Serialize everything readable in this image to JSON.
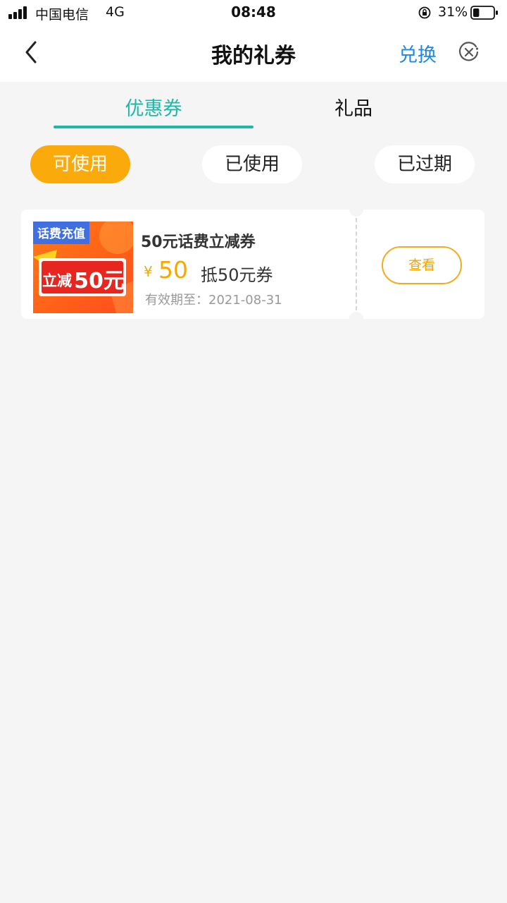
{
  "status_bar": {
    "carrier": "中国电信",
    "network": "4G",
    "time": "08:48",
    "battery_percent": "31%",
    "battery_level": 0.31,
    "icons": [
      "signal-icon",
      "orientation-lock-icon",
      "battery-icon"
    ]
  },
  "nav": {
    "title": "我的礼券",
    "exchange_label": "兑换",
    "back_icon": "back-chevron-icon",
    "close_icon": "close-circle-icon"
  },
  "tabs": [
    {
      "label": "优惠券",
      "active": true
    },
    {
      "label": "礼品",
      "active": false
    }
  ],
  "filters": [
    {
      "label": "可使用",
      "active": true
    },
    {
      "label": "已使用",
      "active": false
    },
    {
      "label": "已过期",
      "active": false
    }
  ],
  "coupons": [
    {
      "image_badge": "话费充值",
      "image_text_prefix": "立减",
      "image_text_amount": "50元",
      "name": "50元话费立减券",
      "currency": "¥",
      "amount": "50",
      "description": "抵50元券",
      "validity": "有效期至：2021-08-31",
      "action_label": "查看"
    }
  ],
  "colors": {
    "accent_teal": "#1cb8a8",
    "filter_active": "#fbaa0c",
    "link_blue": "#1e88e5",
    "price_yellow": "#f6a800"
  }
}
